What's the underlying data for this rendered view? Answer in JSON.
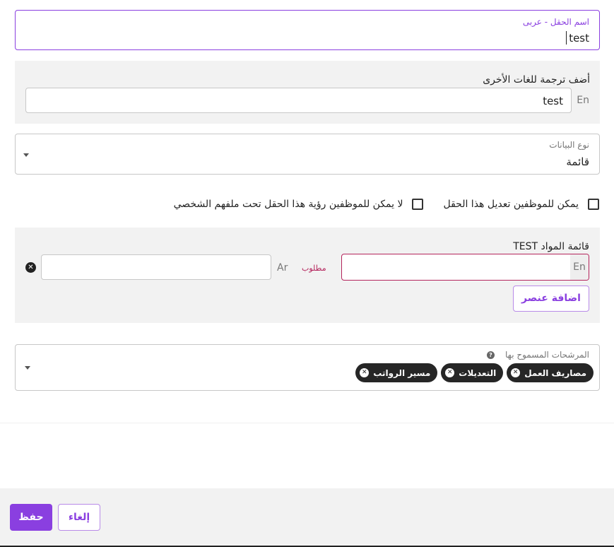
{
  "field_name": {
    "label": "اسم الحقل - عربى",
    "value": "test"
  },
  "translations": {
    "title": "أضف ترجمة للغات الأخرى",
    "lang_code": "En",
    "value": "test"
  },
  "data_type": {
    "label": "نوع البيانات",
    "value": "قائمة"
  },
  "checkboxes": {
    "employees_can_edit": {
      "label": "يمكن للموظفين تعديل هذا الحقل",
      "checked": false
    },
    "employees_cannot_view": {
      "label": "لا يمكن للموظفين رؤية هذا الحقل تحت ملفهم الشخصي",
      "checked": false
    }
  },
  "items_list": {
    "title": "TEST قائمة المواد",
    "en_tag": "En",
    "en_value": "",
    "required_label": "مطلوب",
    "ar_tag": "Ar",
    "ar_value": "",
    "remove_glyph": "✕",
    "add_button": "اضافة عنصر"
  },
  "filters": {
    "label": "المرشحات المسموح بها",
    "help_glyph": "?",
    "chips": [
      "مصاريف العمل",
      "التعديلات",
      "مسير الرواتب"
    ],
    "chip_remove_glyph": "✕"
  },
  "footer": {
    "save": "حفظ",
    "cancel": "إلغاء"
  },
  "colors": {
    "accent": "#8a3fe0",
    "error": "#b4245c",
    "chip_bg": "#262626",
    "panel_bg": "#f2f2f2"
  }
}
